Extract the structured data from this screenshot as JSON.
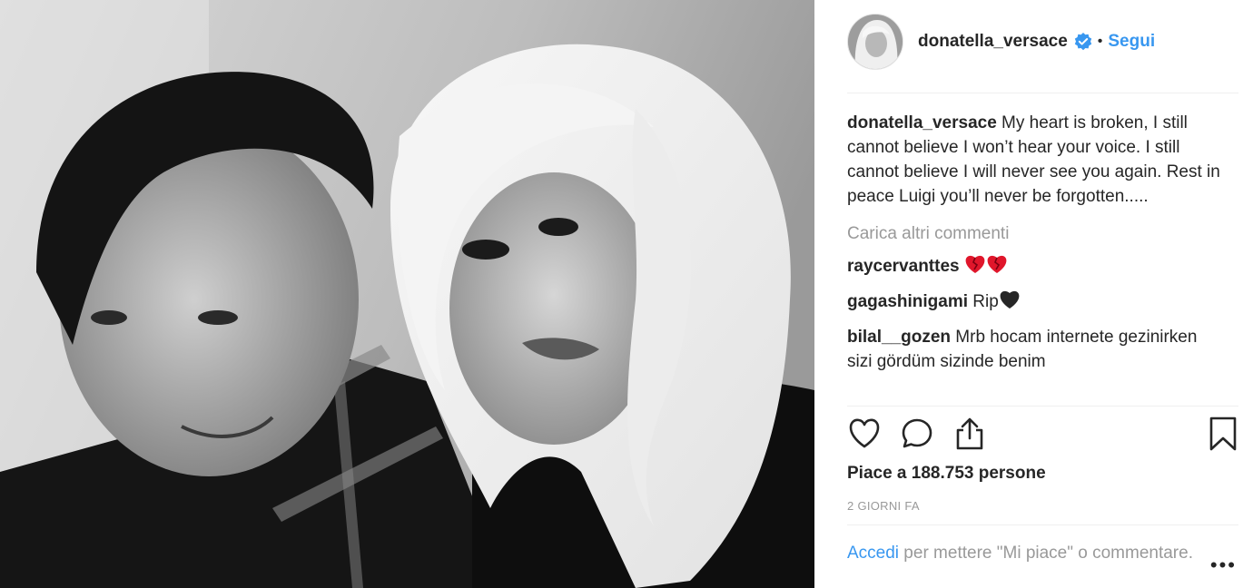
{
  "post": {
    "username": "donatella_versace",
    "follow_label": "Segui",
    "separator": "•",
    "caption_user": "donatella_versace",
    "caption_text": " My heart is broken, I still cannot believe I won’t hear your voice. I still cannot believe I will never see you again. Rest in peace Luigi you’ll never be forgotten.....",
    "load_more": "Carica altri commenti",
    "comments": [
      {
        "user": "raycervanttes",
        "text": "",
        "icons": [
          "broken-heart-icon",
          "broken-heart-icon"
        ]
      },
      {
        "user": "gagashinigami",
        "text": " Rip",
        "icons": [
          "black-heart-icon"
        ]
      },
      {
        "user": "bilal__gozen",
        "text": " Mrb hocam internete gezinirken sizi gördüm sizinde benim",
        "icons": []
      }
    ],
    "likes": "Piace a 188.753 persone",
    "time": "2 GIORNI FA",
    "login_link": "Accedi",
    "login_text": " per mettere \"Mi piace\" o commentare.",
    "more_glyph": "•••"
  },
  "icons": {
    "like": "heart-outline-icon",
    "comment": "comment-bubble-icon",
    "share": "share-icon",
    "save": "bookmark-icon",
    "verified": "verified-badge-icon"
  },
  "colors": {
    "accent": "#3897f0",
    "text": "#262626",
    "muted": "#999999",
    "heart_red": "#e0162b"
  }
}
